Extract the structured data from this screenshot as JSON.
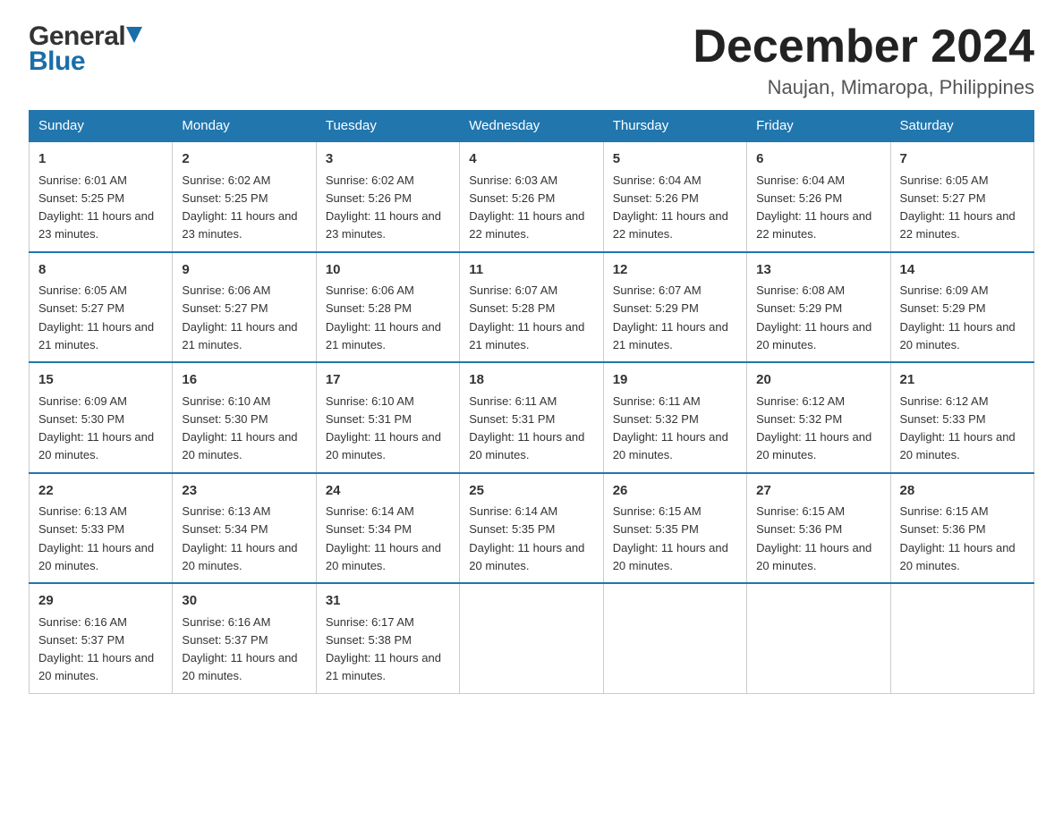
{
  "header": {
    "logo_general": "General",
    "logo_blue": "Blue",
    "month_title": "December 2024",
    "location": "Naujan, Mimaropa, Philippines"
  },
  "days_of_week": [
    "Sunday",
    "Monday",
    "Tuesday",
    "Wednesday",
    "Thursday",
    "Friday",
    "Saturday"
  ],
  "weeks": [
    [
      {
        "day": "1",
        "sunrise": "6:01 AM",
        "sunset": "5:25 PM",
        "daylight": "11 hours and 23 minutes."
      },
      {
        "day": "2",
        "sunrise": "6:02 AM",
        "sunset": "5:25 PM",
        "daylight": "11 hours and 23 minutes."
      },
      {
        "day": "3",
        "sunrise": "6:02 AM",
        "sunset": "5:26 PM",
        "daylight": "11 hours and 23 minutes."
      },
      {
        "day": "4",
        "sunrise": "6:03 AM",
        "sunset": "5:26 PM",
        "daylight": "11 hours and 22 minutes."
      },
      {
        "day": "5",
        "sunrise": "6:04 AM",
        "sunset": "5:26 PM",
        "daylight": "11 hours and 22 minutes."
      },
      {
        "day": "6",
        "sunrise": "6:04 AM",
        "sunset": "5:26 PM",
        "daylight": "11 hours and 22 minutes."
      },
      {
        "day": "7",
        "sunrise": "6:05 AM",
        "sunset": "5:27 PM",
        "daylight": "11 hours and 22 minutes."
      }
    ],
    [
      {
        "day": "8",
        "sunrise": "6:05 AM",
        "sunset": "5:27 PM",
        "daylight": "11 hours and 21 minutes."
      },
      {
        "day": "9",
        "sunrise": "6:06 AM",
        "sunset": "5:27 PM",
        "daylight": "11 hours and 21 minutes."
      },
      {
        "day": "10",
        "sunrise": "6:06 AM",
        "sunset": "5:28 PM",
        "daylight": "11 hours and 21 minutes."
      },
      {
        "day": "11",
        "sunrise": "6:07 AM",
        "sunset": "5:28 PM",
        "daylight": "11 hours and 21 minutes."
      },
      {
        "day": "12",
        "sunrise": "6:07 AM",
        "sunset": "5:29 PM",
        "daylight": "11 hours and 21 minutes."
      },
      {
        "day": "13",
        "sunrise": "6:08 AM",
        "sunset": "5:29 PM",
        "daylight": "11 hours and 20 minutes."
      },
      {
        "day": "14",
        "sunrise": "6:09 AM",
        "sunset": "5:29 PM",
        "daylight": "11 hours and 20 minutes."
      }
    ],
    [
      {
        "day": "15",
        "sunrise": "6:09 AM",
        "sunset": "5:30 PM",
        "daylight": "11 hours and 20 minutes."
      },
      {
        "day": "16",
        "sunrise": "6:10 AM",
        "sunset": "5:30 PM",
        "daylight": "11 hours and 20 minutes."
      },
      {
        "day": "17",
        "sunrise": "6:10 AM",
        "sunset": "5:31 PM",
        "daylight": "11 hours and 20 minutes."
      },
      {
        "day": "18",
        "sunrise": "6:11 AM",
        "sunset": "5:31 PM",
        "daylight": "11 hours and 20 minutes."
      },
      {
        "day": "19",
        "sunrise": "6:11 AM",
        "sunset": "5:32 PM",
        "daylight": "11 hours and 20 minutes."
      },
      {
        "day": "20",
        "sunrise": "6:12 AM",
        "sunset": "5:32 PM",
        "daylight": "11 hours and 20 minutes."
      },
      {
        "day": "21",
        "sunrise": "6:12 AM",
        "sunset": "5:33 PM",
        "daylight": "11 hours and 20 minutes."
      }
    ],
    [
      {
        "day": "22",
        "sunrise": "6:13 AM",
        "sunset": "5:33 PM",
        "daylight": "11 hours and 20 minutes."
      },
      {
        "day": "23",
        "sunrise": "6:13 AM",
        "sunset": "5:34 PM",
        "daylight": "11 hours and 20 minutes."
      },
      {
        "day": "24",
        "sunrise": "6:14 AM",
        "sunset": "5:34 PM",
        "daylight": "11 hours and 20 minutes."
      },
      {
        "day": "25",
        "sunrise": "6:14 AM",
        "sunset": "5:35 PM",
        "daylight": "11 hours and 20 minutes."
      },
      {
        "day": "26",
        "sunrise": "6:15 AM",
        "sunset": "5:35 PM",
        "daylight": "11 hours and 20 minutes."
      },
      {
        "day": "27",
        "sunrise": "6:15 AM",
        "sunset": "5:36 PM",
        "daylight": "11 hours and 20 minutes."
      },
      {
        "day": "28",
        "sunrise": "6:15 AM",
        "sunset": "5:36 PM",
        "daylight": "11 hours and 20 minutes."
      }
    ],
    [
      {
        "day": "29",
        "sunrise": "6:16 AM",
        "sunset": "5:37 PM",
        "daylight": "11 hours and 20 minutes."
      },
      {
        "day": "30",
        "sunrise": "6:16 AM",
        "sunset": "5:37 PM",
        "daylight": "11 hours and 20 minutes."
      },
      {
        "day": "31",
        "sunrise": "6:17 AM",
        "sunset": "5:38 PM",
        "daylight": "11 hours and 21 minutes."
      },
      null,
      null,
      null,
      null
    ]
  ],
  "labels": {
    "sunrise_prefix": "Sunrise: ",
    "sunset_prefix": "Sunset: ",
    "daylight_prefix": "Daylight: "
  }
}
